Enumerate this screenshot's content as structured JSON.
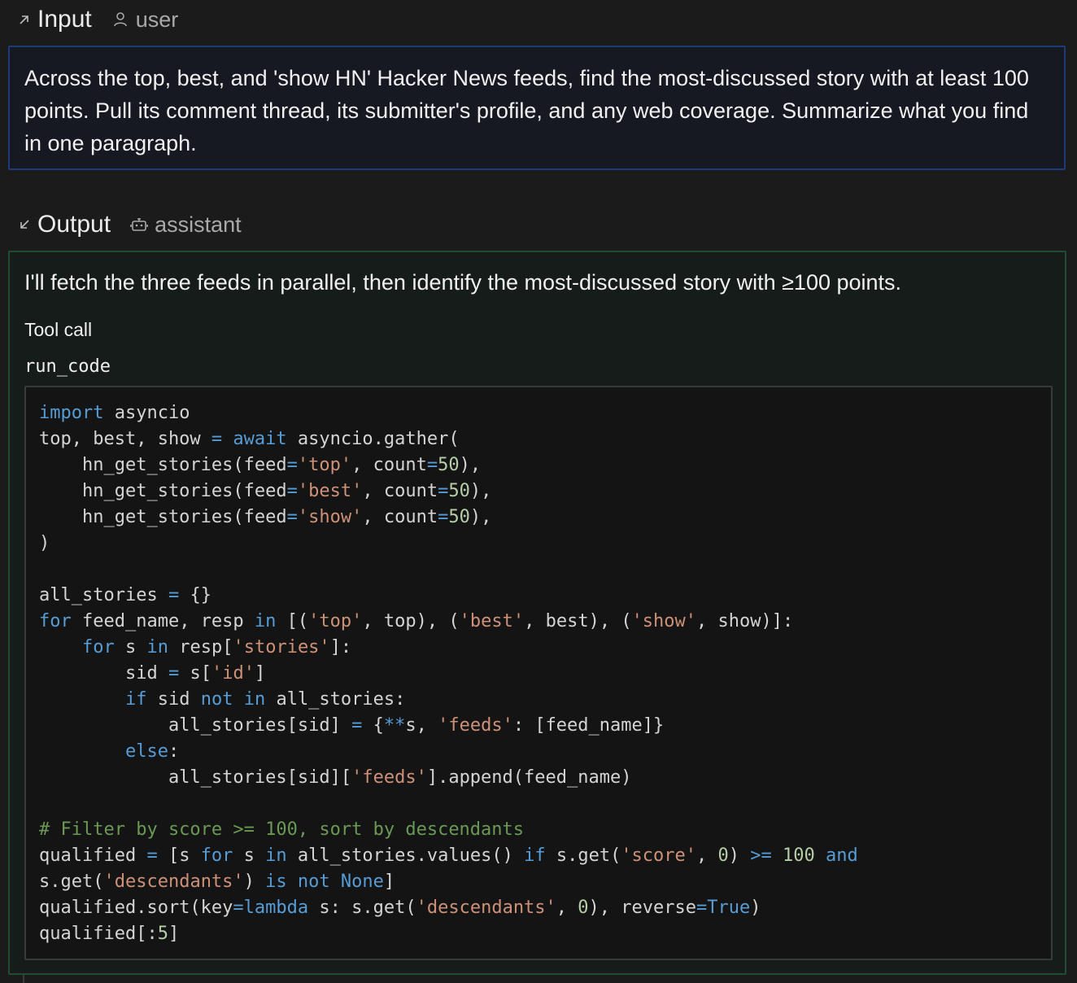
{
  "input": {
    "title": "Input",
    "role": "user",
    "message": "Across the top, best, and 'show HN' Hacker News feeds, find the most-discussed story with at least 100 points. Pull its comment thread, its submitter's profile, and any web coverage. Summarize what you find in one paragraph."
  },
  "output": {
    "title": "Output",
    "role": "assistant",
    "message": "I'll fetch the three feeds in parallel, then identify the most-discussed story with ≥100 points.",
    "tool_call_label": "Tool call",
    "tool_name": "run_code",
    "code": [
      [
        [
          "kw",
          "import"
        ],
        [
          "p",
          " asyncio"
        ]
      ],
      [
        [
          "p",
          "top, best, show "
        ],
        [
          "op",
          "="
        ],
        [
          "p",
          " "
        ],
        [
          "kw",
          "await"
        ],
        [
          "p",
          " asyncio.gather("
        ]
      ],
      [
        [
          "p",
          "    hn_get_stories(feed"
        ],
        [
          "op",
          "="
        ],
        [
          "str",
          "'top'"
        ],
        [
          "p",
          ", count"
        ],
        [
          "op",
          "="
        ],
        [
          "num",
          "50"
        ],
        [
          "p",
          "),"
        ]
      ],
      [
        [
          "p",
          "    hn_get_stories(feed"
        ],
        [
          "op",
          "="
        ],
        [
          "str",
          "'best'"
        ],
        [
          "p",
          ", count"
        ],
        [
          "op",
          "="
        ],
        [
          "num",
          "50"
        ],
        [
          "p",
          "),"
        ]
      ],
      [
        [
          "p",
          "    hn_get_stories(feed"
        ],
        [
          "op",
          "="
        ],
        [
          "str",
          "'show'"
        ],
        [
          "p",
          ", count"
        ],
        [
          "op",
          "="
        ],
        [
          "num",
          "50"
        ],
        [
          "p",
          "),"
        ]
      ],
      [
        [
          "p",
          ")"
        ]
      ],
      [],
      [
        [
          "p",
          "all_stories "
        ],
        [
          "op",
          "="
        ],
        [
          "p",
          " {}"
        ]
      ],
      [
        [
          "kw",
          "for"
        ],
        [
          "p",
          " feed_name, resp "
        ],
        [
          "kw",
          "in"
        ],
        [
          "p",
          " [("
        ],
        [
          "str",
          "'top'"
        ],
        [
          "p",
          ", top), ("
        ],
        [
          "str",
          "'best'"
        ],
        [
          "p",
          ", best), ("
        ],
        [
          "str",
          "'show'"
        ],
        [
          "p",
          ", show)]:"
        ]
      ],
      [
        [
          "p",
          "    "
        ],
        [
          "kw",
          "for"
        ],
        [
          "p",
          " s "
        ],
        [
          "kw",
          "in"
        ],
        [
          "p",
          " resp["
        ],
        [
          "str",
          "'stories'"
        ],
        [
          "p",
          "]:"
        ]
      ],
      [
        [
          "p",
          "        sid "
        ],
        [
          "op",
          "="
        ],
        [
          "p",
          " s["
        ],
        [
          "str",
          "'id'"
        ],
        [
          "p",
          "]"
        ]
      ],
      [
        [
          "p",
          "        "
        ],
        [
          "kw",
          "if"
        ],
        [
          "p",
          " sid "
        ],
        [
          "kw",
          "not"
        ],
        [
          "p",
          " "
        ],
        [
          "kw",
          "in"
        ],
        [
          "p",
          " all_stories:"
        ]
      ],
      [
        [
          "p",
          "            all_stories[sid] "
        ],
        [
          "op",
          "="
        ],
        [
          "p",
          " {"
        ],
        [
          "op",
          "**"
        ],
        [
          "p",
          "s, "
        ],
        [
          "str",
          "'feeds'"
        ],
        [
          "p",
          ": [feed_name]}"
        ]
      ],
      [
        [
          "p",
          "        "
        ],
        [
          "kw",
          "else"
        ],
        [
          "p",
          ":"
        ]
      ],
      [
        [
          "p",
          "            all_stories[sid]["
        ],
        [
          "str",
          "'feeds'"
        ],
        [
          "p",
          "].append(feed_name)"
        ]
      ],
      [],
      [
        [
          "com",
          "# Filter by score >= 100, sort by descendants"
        ]
      ],
      [
        [
          "p",
          "qualified "
        ],
        [
          "op",
          "="
        ],
        [
          "p",
          " [s "
        ],
        [
          "kw",
          "for"
        ],
        [
          "p",
          " s "
        ],
        [
          "kw",
          "in"
        ],
        [
          "p",
          " all_stories.values() "
        ],
        [
          "kw",
          "if"
        ],
        [
          "p",
          " s.get("
        ],
        [
          "str",
          "'score'"
        ],
        [
          "p",
          ", "
        ],
        [
          "num",
          "0"
        ],
        [
          "p",
          ") "
        ],
        [
          "op",
          ">="
        ],
        [
          "p",
          " "
        ],
        [
          "num",
          "100"
        ],
        [
          "p",
          " "
        ],
        [
          "kw",
          "and"
        ]
      ],
      [
        [
          "p",
          "s.get("
        ],
        [
          "str",
          "'descendants'"
        ],
        [
          "p",
          ") "
        ],
        [
          "kw",
          "is"
        ],
        [
          "p",
          " "
        ],
        [
          "kw",
          "not"
        ],
        [
          "p",
          " "
        ],
        [
          "kw",
          "None"
        ],
        [
          "p",
          "]"
        ]
      ],
      [
        [
          "p",
          "qualified.sort(key"
        ],
        [
          "op",
          "="
        ],
        [
          "kw",
          "lambda"
        ],
        [
          "p",
          " s: s.get("
        ],
        [
          "str",
          "'descendants'"
        ],
        [
          "p",
          ", "
        ],
        [
          "num",
          "0"
        ],
        [
          "p",
          "), reverse"
        ],
        [
          "op",
          "="
        ],
        [
          "kw",
          "True"
        ],
        [
          "p",
          ")"
        ]
      ],
      [
        [
          "p",
          "qualified[:"
        ],
        [
          "num",
          "5"
        ],
        [
          "p",
          "]"
        ]
      ]
    ]
  }
}
